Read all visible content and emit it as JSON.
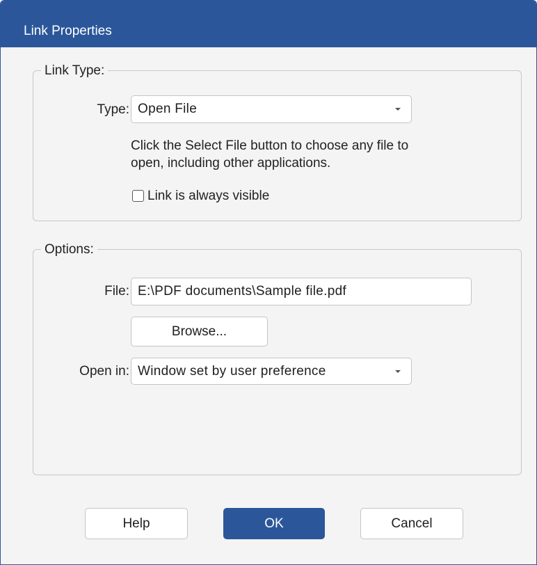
{
  "dialog": {
    "title": "Link Properties"
  },
  "link_type": {
    "group_label": "Link Type:",
    "type_label": "Type:",
    "type_value": "Open File",
    "description_line1": "Click the Select File button to choose any file to",
    "description_line2": "open, including other applications.",
    "always_visible_label": "Link is always visible",
    "always_visible_checked": false
  },
  "options": {
    "group_label": "Options:",
    "file_label": "File:",
    "file_value": "E:\\PDF documents\\Sample file.pdf",
    "browse_label": "Browse...",
    "open_in_label": "Open in:",
    "open_in_value": "Window set by user preference"
  },
  "buttons": {
    "help": "Help",
    "ok": "OK",
    "cancel": "Cancel"
  },
  "colors": {
    "accent": "#2b579a",
    "background": "#f4f4f4"
  }
}
